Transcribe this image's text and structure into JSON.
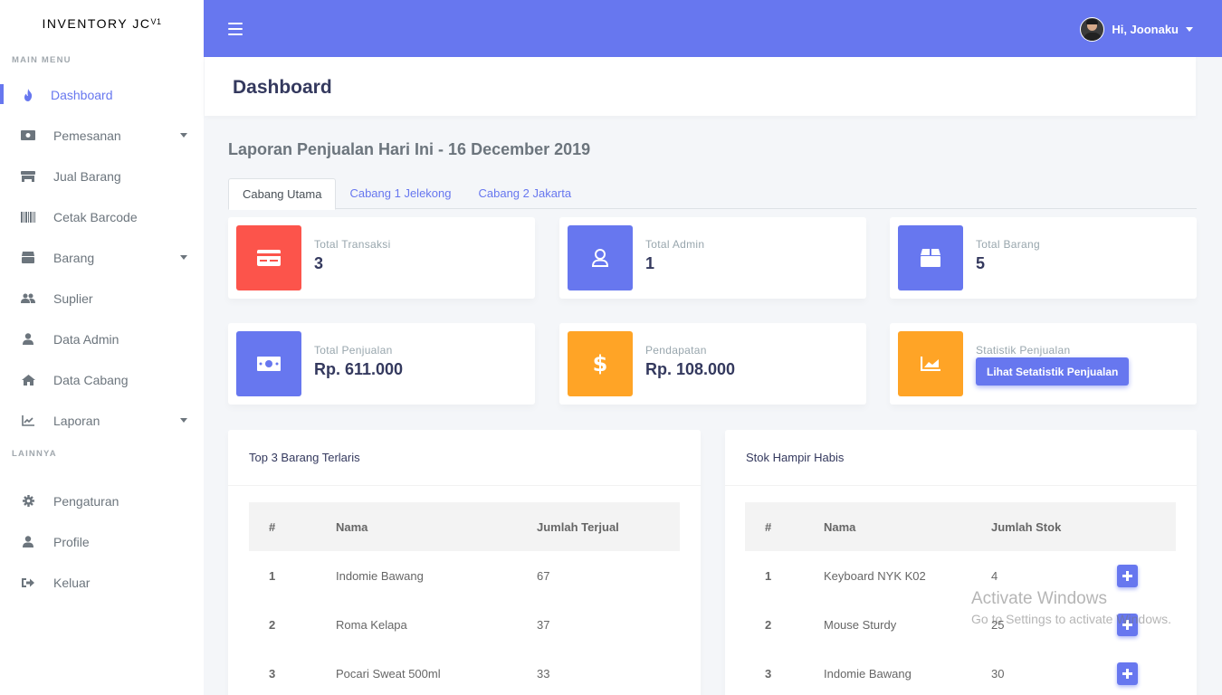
{
  "brand": {
    "name": "INVENTORY JC",
    "version": "V1"
  },
  "sidebar": {
    "main_header": "MAIN MENU",
    "items": [
      {
        "label": "Dashboard",
        "icon": "fire-icon",
        "active": true
      },
      {
        "label": "Pemesanan",
        "icon": "money-bill-icon",
        "dropdown": true
      },
      {
        "label": "Jual Barang",
        "icon": "store-icon"
      },
      {
        "label": "Cetak Barcode",
        "icon": "barcode-icon"
      },
      {
        "label": "Barang",
        "icon": "box-icon",
        "dropdown": true
      },
      {
        "label": "Suplier",
        "icon": "users-icon"
      },
      {
        "label": "Data Admin",
        "icon": "user-icon"
      },
      {
        "label": "Data Cabang",
        "icon": "home-icon"
      },
      {
        "label": "Laporan",
        "icon": "chart-line-icon",
        "dropdown": true
      }
    ],
    "other_header": "LAINNYA",
    "other_items": [
      {
        "label": "Pengaturan",
        "icon": "cog-icon"
      },
      {
        "label": "Profile",
        "icon": "user-icon"
      },
      {
        "label": "Keluar",
        "icon": "sign-out-icon"
      }
    ]
  },
  "navbar": {
    "greeting": "Hi, Joonaku"
  },
  "page": {
    "title": "Dashboard",
    "report_title": "Laporan Penjualan Hari Ini - 16 December 2019"
  },
  "tabs": [
    "Cabang Utama",
    "Cabang 1 Jelekong",
    "Cabang 2 Jakarta"
  ],
  "stats": [
    {
      "label": "Total Transaksi",
      "value": "3",
      "color": "#fc544b",
      "icon": "credit-card-icon"
    },
    {
      "label": "Total Admin",
      "value": "1",
      "color": "#6777ef",
      "icon": "user-icon"
    },
    {
      "label": "Total Barang",
      "value": "5",
      "color": "#6777ef",
      "icon": "box-icon"
    },
    {
      "label": "Total Penjualan",
      "value": "Rp. 611.000",
      "color": "#6777ef",
      "icon": "money-bill-icon"
    },
    {
      "label": "Pendapatan",
      "value": "Rp. 108.000",
      "color": "#ffa426",
      "icon": "dollar-icon"
    },
    {
      "label": "Statistik Penjualan",
      "button": "Lihat Setatistik Penjualan",
      "color": "#ffa426",
      "icon": "chart-area-icon"
    }
  ],
  "top_items": {
    "title": "Top 3 Barang Terlaris",
    "headers": [
      "#",
      "Nama",
      "Jumlah Terjual"
    ],
    "rows": [
      [
        "1",
        "Indomie Bawang",
        "67"
      ],
      [
        "2",
        "Roma Kelapa",
        "37"
      ],
      [
        "3",
        "Pocari Sweat 500ml",
        "33"
      ]
    ]
  },
  "low_stock": {
    "title": "Stok Hampir Habis",
    "headers": [
      "#",
      "Nama",
      "Jumlah Stok"
    ],
    "rows": [
      [
        "1",
        "Keyboard NYK K02",
        "4"
      ],
      [
        "2",
        "Mouse Sturdy",
        "25"
      ],
      [
        "3",
        "Indomie Bawang",
        "30"
      ]
    ]
  },
  "watermark": {
    "line1": "Activate Windows",
    "line2": "Go to Settings to activate Windows."
  }
}
